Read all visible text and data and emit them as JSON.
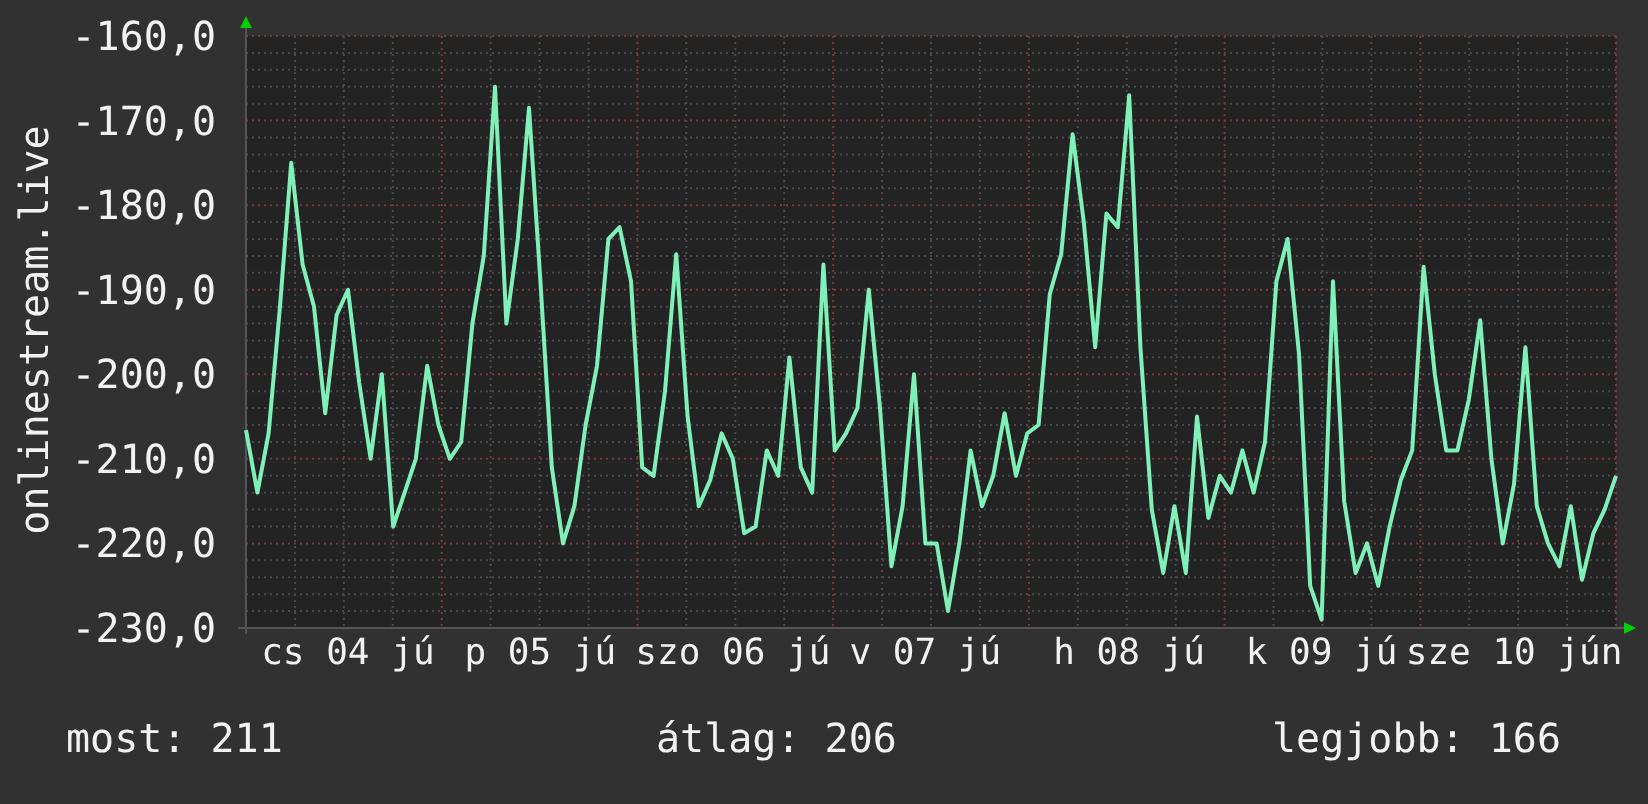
{
  "chart": {
    "chart_data": {
      "type": "line",
      "ylabel": "onlinestream.live",
      "ylim": [
        -230,
        -160
      ],
      "grid": true,
      "yticks": [
        {
          "value": -160,
          "label": "-160,0"
        },
        {
          "value": -170,
          "label": "-170,0"
        },
        {
          "value": -180,
          "label": "-180,0"
        },
        {
          "value": -190,
          "label": "-190,0"
        },
        {
          "value": -200,
          "label": "-200,0"
        },
        {
          "value": -210,
          "label": "-210,0"
        },
        {
          "value": -220,
          "label": "-220,0"
        },
        {
          "value": -230,
          "label": "-230,0"
        }
      ],
      "categories": [
        null,
        null,
        null,
        null,
        null,
        null,
        null,
        null,
        null,
        "cs 04 jú",
        null,
        null,
        null,
        null,
        null,
        null,
        null,
        null,
        null,
        null,
        null,
        null,
        null,
        null,
        null,
        null,
        "p 05 jú",
        null,
        null,
        null,
        null,
        null,
        null,
        null,
        null,
        null,
        null,
        null,
        null,
        null,
        null,
        null,
        null,
        "szo 06 jú",
        null,
        null,
        null,
        null,
        null,
        null,
        null,
        null,
        null,
        null,
        null,
        null,
        null,
        null,
        null,
        null,
        "v 07 jú",
        null,
        null,
        null,
        null,
        null,
        null,
        null,
        null,
        null,
        null,
        null,
        null,
        null,
        null,
        null,
        null,
        null,
        "h 08 jú",
        null,
        null,
        null,
        null,
        null,
        null,
        null,
        null,
        null,
        null,
        null,
        null,
        null,
        null,
        null,
        null,
        "k 09 jú",
        null,
        null,
        null,
        null,
        null,
        null,
        null,
        null,
        null,
        null,
        null,
        null,
        null,
        null,
        null,
        null,
        "sze 10 jún",
        null,
        null,
        null,
        null,
        null,
        null,
        null,
        null,
        null
      ],
      "series": [
        {
          "color": "#7ff0b8",
          "values": [
            -206.6,
            -214,
            -207,
            -192,
            -175,
            -187,
            -192,
            -204.6,
            -193,
            -190,
            -201,
            -210,
            -200,
            -218,
            -214,
            -210,
            -199,
            -206,
            -210,
            -208,
            -194,
            -186,
            -166,
            -194,
            -184,
            -168.5,
            -189,
            -211,
            -220,
            -215.6,
            -206,
            -199,
            -184,
            -182.6,
            -189,
            -211,
            -212,
            -202,
            -185.8,
            -205,
            -215.6,
            -212.5,
            -207,
            -210,
            -218.8,
            -218,
            -209,
            -212,
            -198,
            -211,
            -214,
            -187,
            -209,
            -207,
            -204,
            -190,
            -204,
            -222.7,
            -215.6,
            -200,
            -220,
            -220,
            -228,
            -220,
            -209,
            -215.6,
            -212,
            -204.6,
            -212,
            -207,
            -206,
            -190.5,
            -185.8,
            -171.6,
            -182,
            -196.8,
            -181,
            -182.6,
            -167,
            -196.8,
            -216,
            -223.5,
            -215.6,
            -223.5,
            -205,
            -217,
            -212,
            -214,
            -209,
            -214,
            -208,
            -189,
            -184,
            -197.6,
            -225,
            -229,
            -189,
            -215,
            -223.5,
            -220,
            -225,
            -218,
            -212.5,
            -209,
            -187.3,
            -200,
            -209,
            -209,
            -203,
            -193.6,
            -210,
            -220,
            -213,
            -196.8,
            -215.6,
            -220,
            -222.7,
            -215.6,
            -224.3,
            -218.8,
            -216,
            -212
          ]
        }
      ]
    }
  },
  "footer": [
    "most: 211",
    "átlag: 206",
    "legjobb: 166"
  ]
}
